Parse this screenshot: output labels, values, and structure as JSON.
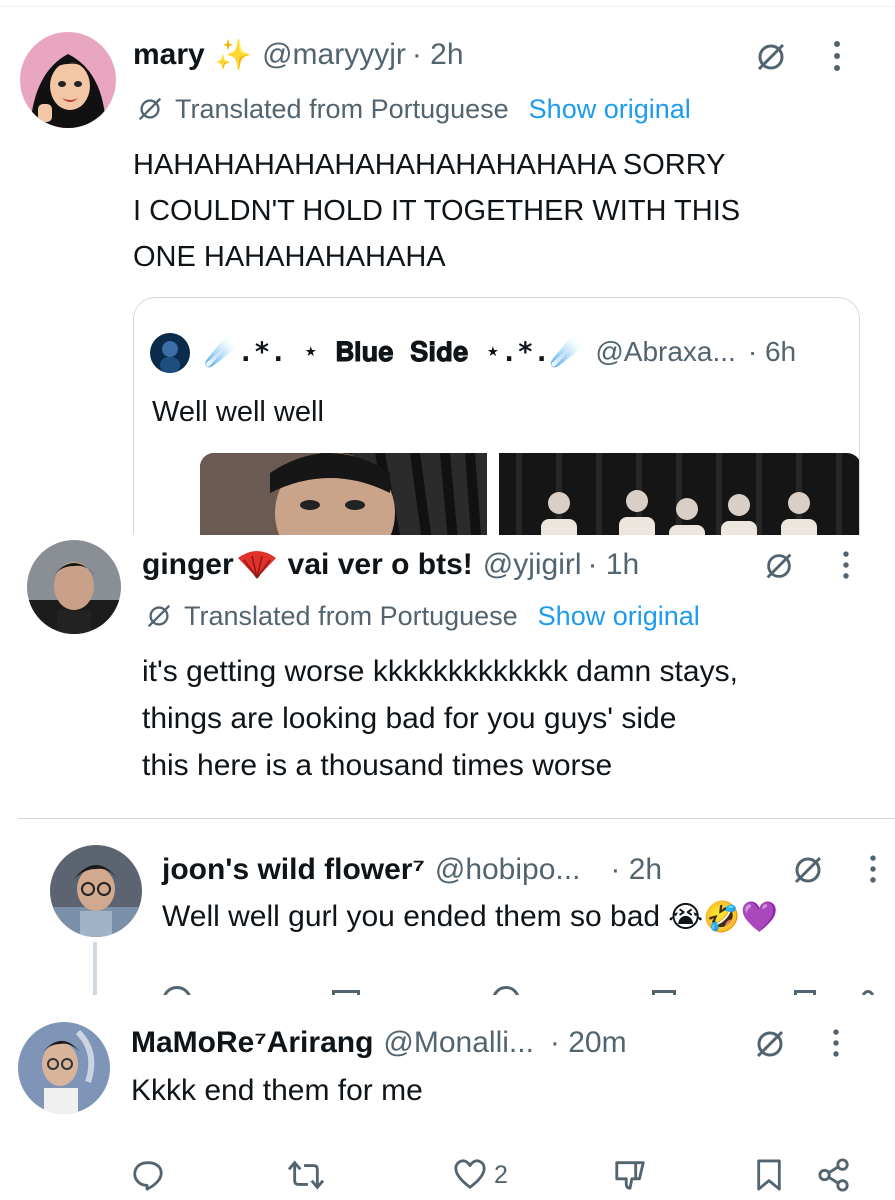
{
  "tweet1": {
    "display_name": "mary",
    "name_emoji": "✨",
    "handle": "@maryyyjr",
    "time": "· 2h",
    "translated_label": "Translated from Portuguese",
    "show_original": "Show original",
    "lines": [
      "HAHAHAHAHAHAHAHAHAHAHAHA SORRY",
      "I COULDN'T HOLD IT TOGETHER WITH THIS",
      "ONE HAHAHAHAHAHA"
    ],
    "quote": {
      "display_name": "☄️.*. ⋆ 𝐁𝐥𝐮𝐞 𝐒𝐢𝐝𝐞 ⋆.*.☄️",
      "handle": "@Abraxa...",
      "time": "· 6h",
      "text": "Well well well"
    }
  },
  "tweet2": {
    "display_name": "ginger",
    "name_suffix": "vai ver o bts!",
    "handle": "@yjigirl",
    "time": "· 1h",
    "translated_label": "Translated from Portuguese",
    "show_original": "Show original",
    "lines": [
      "it's getting worse kkkkkkkkkkkkk damn stays,",
      "things are looking bad for you guys' side",
      "this here is a thousand times worse"
    ]
  },
  "tweet3": {
    "display_name": "joon's wild flower⁷",
    "handle": "@hobipo...",
    "time": "· 2h",
    "text": "Well well gurl you ended them so bad",
    "emojis": "😭🤣💜"
  },
  "tweet4": {
    "display_name": "MaMoRe⁷Arirang",
    "handle": "@Monalli...",
    "time": "· 20m",
    "text": "Kkkk end them for me",
    "like_count": "2"
  },
  "colors": {
    "text": "#0f1419",
    "muted": "#536471",
    "link": "#1d9bf0",
    "divider": "#eff3f4"
  }
}
